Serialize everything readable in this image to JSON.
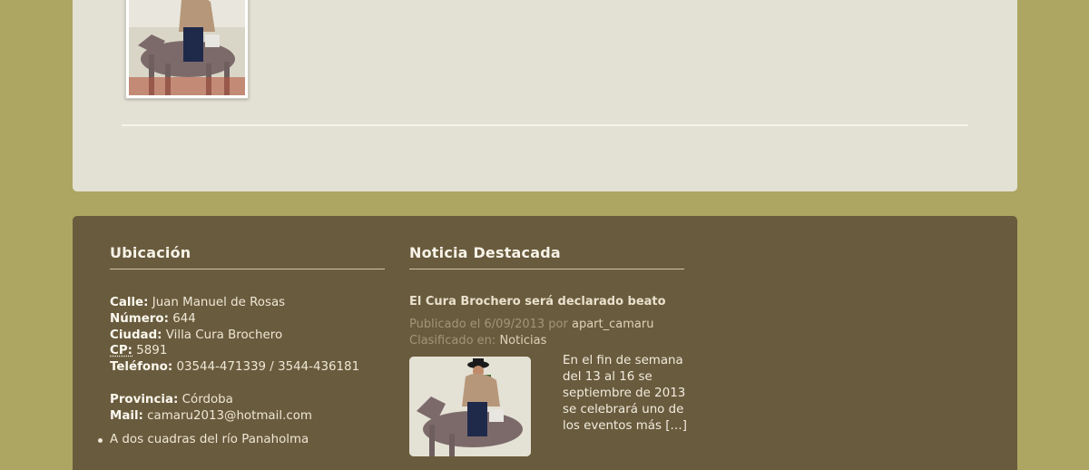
{
  "footer": {
    "location": {
      "title": "Ubicación",
      "calle_k": "Calle:",
      "calle_v": "Juan Manuel de Rosas",
      "numero_k": "Número:",
      "numero_v": "644",
      "ciudad_k": "Ciudad:",
      "ciudad_v": "Villa Cura Brochero",
      "cp_k": "CP:",
      "cp_v": "5891",
      "tel_k": "Teléfono:",
      "tel_v": "03544-471339 / 3544-436181",
      "prov_k": "Provincia:",
      "prov_v": "Córdoba",
      "mail_k": "Mail:",
      "mail_v": "camaru2013@hotmail.com",
      "items": [
        "A dos cuadras del río Panaholma"
      ]
    },
    "news": {
      "title": "Noticia Destacada",
      "post_title": "El Cura Brochero será declarado beato",
      "published_prefix": "Publicado el 6/09/2013 por",
      "author": "apart_camaru",
      "classified_prefix": "Clasificado en:",
      "category": "Noticias",
      "excerpt": "En el fin de semana del 13 al 16 se septiembre de 2013 se celebrará uno de los eventos más […]"
    }
  }
}
